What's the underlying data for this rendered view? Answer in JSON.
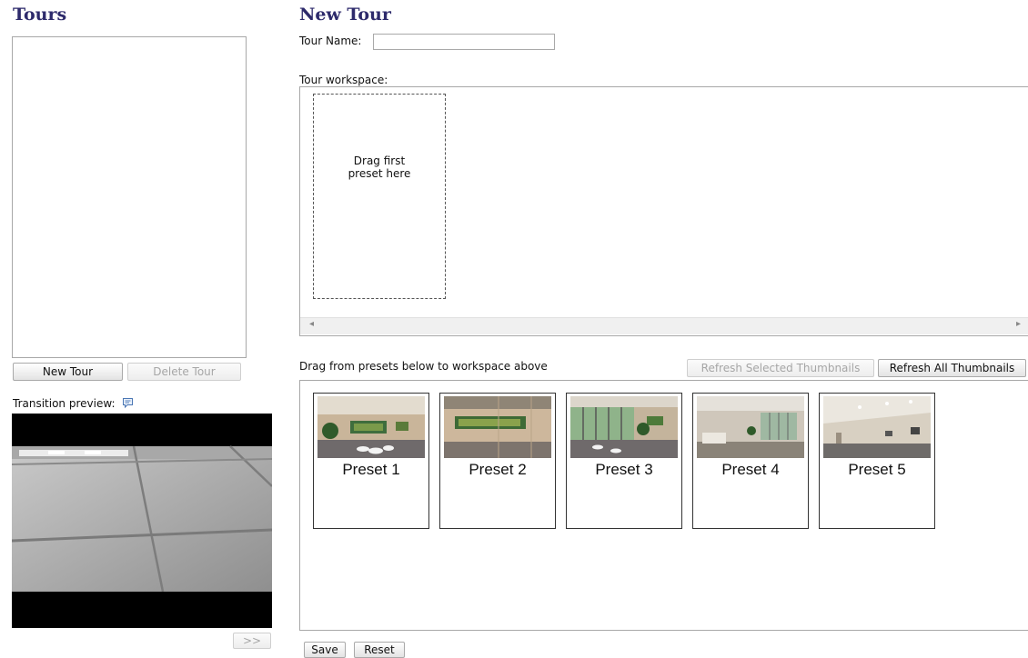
{
  "tours": {
    "title": "Tours",
    "new_button": "New Tour",
    "delete_button": "Delete Tour",
    "transition_label": "Transition preview:",
    "next_button": ">>"
  },
  "new_tour": {
    "title": "New Tour",
    "name_label": "Tour Name:",
    "name_value": "",
    "workspace_label": "Tour workspace:",
    "drop_hint": "Drag first preset here",
    "scroll_left": "◂",
    "scroll_right": "▸"
  },
  "presets": {
    "instruction": "Drag from presets below to workspace above",
    "refresh_selected": "Refresh Selected Thumbnails",
    "refresh_all": "Refresh All Thumbnails",
    "items": [
      {
        "label": "Preset 1"
      },
      {
        "label": "Preset 2"
      },
      {
        "label": "Preset 3"
      },
      {
        "label": "Preset 4"
      },
      {
        "label": "Preset 5"
      }
    ]
  },
  "footer": {
    "save": "Save",
    "reset": "Reset"
  },
  "icons": {
    "info": "speech-bubble-icon"
  },
  "colors": {
    "heading": "#2d2a6b",
    "border": "#a8a8a8"
  }
}
